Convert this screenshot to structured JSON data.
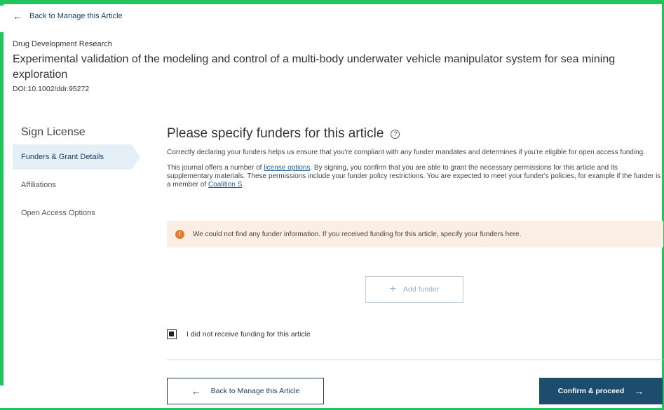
{
  "header": {
    "back_link": "Back to Manage this Article",
    "journal": "Drug Development Research",
    "article_title": "Experimental validation of the modeling and control of a multi-body underwater vehicle manipulator system for sea mining exploration",
    "doi": "DOI:10.1002/ddr.95272"
  },
  "sidebar": {
    "title": "Sign License",
    "items": [
      {
        "label": "Funders & Grant Details",
        "active": true
      },
      {
        "label": "Affiliations",
        "active": false
      },
      {
        "label": "Open Access Options",
        "active": false
      }
    ]
  },
  "main": {
    "heading": "Please specify funders for this article",
    "help_icon": "?",
    "para1": "Correctly declaring your funders helps us ensure that you're compliant with any funder mandates and determines if you're eligible for open access funding.",
    "para2_before_link": "This journal offers a number of ",
    "para2_link": "license options",
    "para2_after_link": ". By signing, you confirm that you are able to grant the necessary permissions for this article and its supplementary materials. These permissions include your funder policy restrictions. You are expected to meet your funder's policies, for example if the funder is a member of ",
    "para2_link2": "Coalition S",
    "para2_end": ".",
    "alert_icon": "!",
    "alert_text": "We could not find any funder information. If you received funding for this article, specify your funders here.",
    "add_funder_label": "Add funder",
    "add_funder_icon": "+",
    "checkbox_label": "I did not receive funding for this article",
    "checkbox_checked": true,
    "back_button_label": "Back to Manage this Article",
    "confirm_button_label": "Confirm & proceed"
  },
  "colors": {
    "frame": "#22c45e",
    "primary": "#1c4d6e",
    "alert_bg": "#fbeee4",
    "alert_icon": "#e07c2b"
  },
  "icons": {
    "back": "arrow-left-icon",
    "forward": "arrow-right-icon",
    "info": "info-icon",
    "help": "help-circle-icon",
    "add": "plus-icon"
  }
}
